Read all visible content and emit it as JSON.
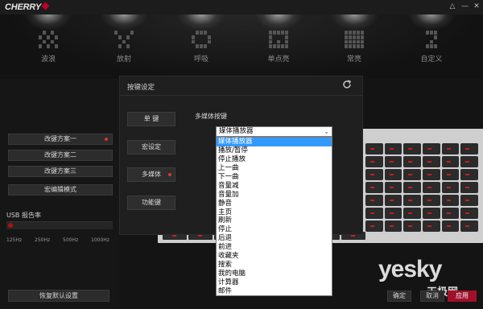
{
  "app": {
    "logo_text": "CHERRY",
    "window_controls": [
      "△",
      "—",
      "✕"
    ]
  },
  "modes": [
    {
      "label": "波浪",
      "icon": "wave-mode-icon"
    },
    {
      "label": "放射",
      "icon": "radiate-mode-icon"
    },
    {
      "label": "呼吸",
      "icon": "breathing-mode-icon"
    },
    {
      "label": "单点亮",
      "icon": "single-key-mode-icon"
    },
    {
      "label": "常亮",
      "icon": "static-mode-icon"
    },
    {
      "label": "自定义",
      "icon": "custom-mode-icon"
    }
  ],
  "left_panel": {
    "schemes": [
      {
        "label": "改键方案一",
        "active": true
      },
      {
        "label": "改键方案二",
        "active": false
      },
      {
        "label": "改键方案三",
        "active": false
      },
      {
        "label": "宏编辑模式",
        "active": false
      }
    ],
    "usb": {
      "title": "USB 报告率",
      "rates": [
        "125Hz",
        "250Hz",
        "500Hz",
        "1000Hz"
      ],
      "selected": "125Hz"
    },
    "reset_label": "恢复默认设置"
  },
  "dialog": {
    "title": "按键设定",
    "tabs": [
      {
        "label": "单  键",
        "active": false
      },
      {
        "label": "宏设定",
        "active": false
      },
      {
        "label": "多媒体",
        "active": true
      },
      {
        "label": "功能键",
        "active": false
      }
    ],
    "section_label": "多媒体按键",
    "select": {
      "value": "媒体播放器",
      "options": [
        "媒体播放器",
        "播放/暂停",
        "停止播放",
        "上一曲",
        "下一曲",
        "音量减",
        "音量加",
        "静音",
        "主页",
        "刷新",
        "停止",
        "后退",
        "前进",
        "收藏夹",
        "搜索",
        "我的电脑",
        "计算器",
        "邮件"
      ],
      "highlighted_index": 0
    }
  },
  "footer": {
    "ok_label": "确定",
    "cancel_label": "取消",
    "apply_label": "应用"
  },
  "watermark": {
    "main": "yesky",
    "sub": "天极网"
  },
  "colors": {
    "accent": "#a0102a",
    "selection": "#3399ff",
    "background": "#141414"
  }
}
